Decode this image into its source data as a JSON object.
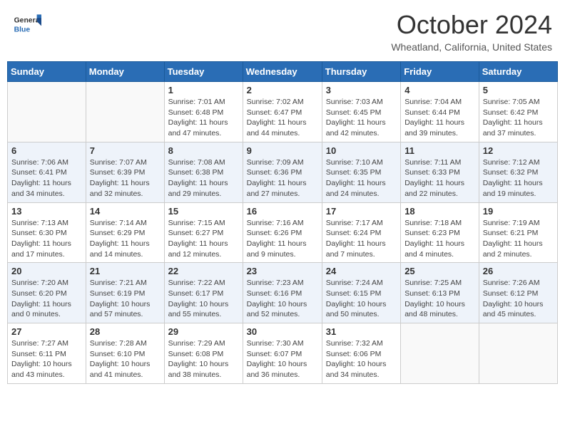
{
  "header": {
    "logo_general": "General",
    "logo_blue": "Blue",
    "month": "October 2024",
    "location": "Wheatland, California, United States"
  },
  "days_of_week": [
    "Sunday",
    "Monday",
    "Tuesday",
    "Wednesday",
    "Thursday",
    "Friday",
    "Saturday"
  ],
  "weeks": [
    [
      {
        "day": "",
        "info": ""
      },
      {
        "day": "",
        "info": ""
      },
      {
        "day": "1",
        "info": "Sunrise: 7:01 AM\nSunset: 6:48 PM\nDaylight: 11 hours and 47 minutes."
      },
      {
        "day": "2",
        "info": "Sunrise: 7:02 AM\nSunset: 6:47 PM\nDaylight: 11 hours and 44 minutes."
      },
      {
        "day": "3",
        "info": "Sunrise: 7:03 AM\nSunset: 6:45 PM\nDaylight: 11 hours and 42 minutes."
      },
      {
        "day": "4",
        "info": "Sunrise: 7:04 AM\nSunset: 6:44 PM\nDaylight: 11 hours and 39 minutes."
      },
      {
        "day": "5",
        "info": "Sunrise: 7:05 AM\nSunset: 6:42 PM\nDaylight: 11 hours and 37 minutes."
      }
    ],
    [
      {
        "day": "6",
        "info": "Sunrise: 7:06 AM\nSunset: 6:41 PM\nDaylight: 11 hours and 34 minutes."
      },
      {
        "day": "7",
        "info": "Sunrise: 7:07 AM\nSunset: 6:39 PM\nDaylight: 11 hours and 32 minutes."
      },
      {
        "day": "8",
        "info": "Sunrise: 7:08 AM\nSunset: 6:38 PM\nDaylight: 11 hours and 29 minutes."
      },
      {
        "day": "9",
        "info": "Sunrise: 7:09 AM\nSunset: 6:36 PM\nDaylight: 11 hours and 27 minutes."
      },
      {
        "day": "10",
        "info": "Sunrise: 7:10 AM\nSunset: 6:35 PM\nDaylight: 11 hours and 24 minutes."
      },
      {
        "day": "11",
        "info": "Sunrise: 7:11 AM\nSunset: 6:33 PM\nDaylight: 11 hours and 22 minutes."
      },
      {
        "day": "12",
        "info": "Sunrise: 7:12 AM\nSunset: 6:32 PM\nDaylight: 11 hours and 19 minutes."
      }
    ],
    [
      {
        "day": "13",
        "info": "Sunrise: 7:13 AM\nSunset: 6:30 PM\nDaylight: 11 hours and 17 minutes."
      },
      {
        "day": "14",
        "info": "Sunrise: 7:14 AM\nSunset: 6:29 PM\nDaylight: 11 hours and 14 minutes."
      },
      {
        "day": "15",
        "info": "Sunrise: 7:15 AM\nSunset: 6:27 PM\nDaylight: 11 hours and 12 minutes."
      },
      {
        "day": "16",
        "info": "Sunrise: 7:16 AM\nSunset: 6:26 PM\nDaylight: 11 hours and 9 minutes."
      },
      {
        "day": "17",
        "info": "Sunrise: 7:17 AM\nSunset: 6:24 PM\nDaylight: 11 hours and 7 minutes."
      },
      {
        "day": "18",
        "info": "Sunrise: 7:18 AM\nSunset: 6:23 PM\nDaylight: 11 hours and 4 minutes."
      },
      {
        "day": "19",
        "info": "Sunrise: 7:19 AM\nSunset: 6:21 PM\nDaylight: 11 hours and 2 minutes."
      }
    ],
    [
      {
        "day": "20",
        "info": "Sunrise: 7:20 AM\nSunset: 6:20 PM\nDaylight: 11 hours and 0 minutes."
      },
      {
        "day": "21",
        "info": "Sunrise: 7:21 AM\nSunset: 6:19 PM\nDaylight: 10 hours and 57 minutes."
      },
      {
        "day": "22",
        "info": "Sunrise: 7:22 AM\nSunset: 6:17 PM\nDaylight: 10 hours and 55 minutes."
      },
      {
        "day": "23",
        "info": "Sunrise: 7:23 AM\nSunset: 6:16 PM\nDaylight: 10 hours and 52 minutes."
      },
      {
        "day": "24",
        "info": "Sunrise: 7:24 AM\nSunset: 6:15 PM\nDaylight: 10 hours and 50 minutes."
      },
      {
        "day": "25",
        "info": "Sunrise: 7:25 AM\nSunset: 6:13 PM\nDaylight: 10 hours and 48 minutes."
      },
      {
        "day": "26",
        "info": "Sunrise: 7:26 AM\nSunset: 6:12 PM\nDaylight: 10 hours and 45 minutes."
      }
    ],
    [
      {
        "day": "27",
        "info": "Sunrise: 7:27 AM\nSunset: 6:11 PM\nDaylight: 10 hours and 43 minutes."
      },
      {
        "day": "28",
        "info": "Sunrise: 7:28 AM\nSunset: 6:10 PM\nDaylight: 10 hours and 41 minutes."
      },
      {
        "day": "29",
        "info": "Sunrise: 7:29 AM\nSunset: 6:08 PM\nDaylight: 10 hours and 38 minutes."
      },
      {
        "day": "30",
        "info": "Sunrise: 7:30 AM\nSunset: 6:07 PM\nDaylight: 10 hours and 36 minutes."
      },
      {
        "day": "31",
        "info": "Sunrise: 7:32 AM\nSunset: 6:06 PM\nDaylight: 10 hours and 34 minutes."
      },
      {
        "day": "",
        "info": ""
      },
      {
        "day": "",
        "info": ""
      }
    ]
  ]
}
